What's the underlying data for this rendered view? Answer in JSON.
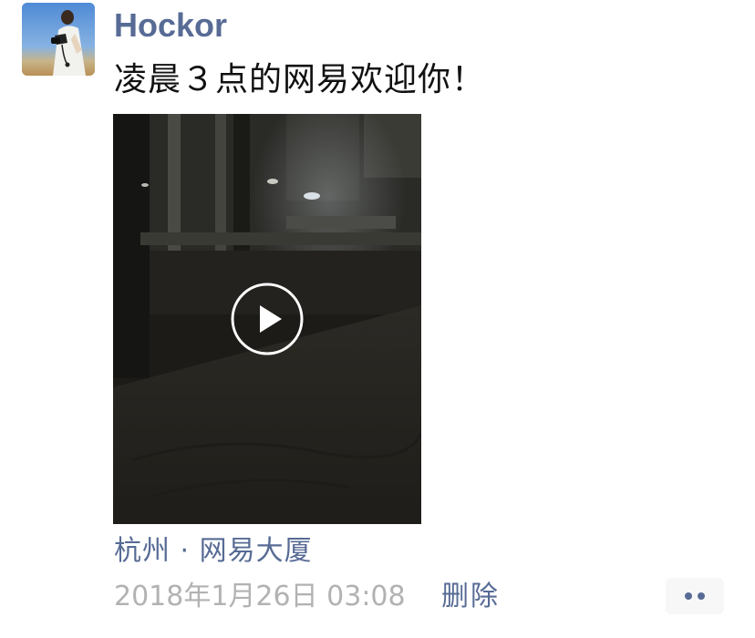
{
  "post": {
    "author": "Hockor",
    "text": "凌晨３点的网易欢迎你！",
    "location": "杭州 · 网易大厦",
    "timestamp": "2018年1月26日 03:08",
    "delete_label": "删除"
  },
  "icons": {
    "play": "play-icon",
    "more": "more-dots-icon"
  },
  "colors": {
    "link": "#576b95",
    "text": "#111111",
    "muted": "#b2b2b2",
    "more_bg": "#f7f7f7"
  }
}
